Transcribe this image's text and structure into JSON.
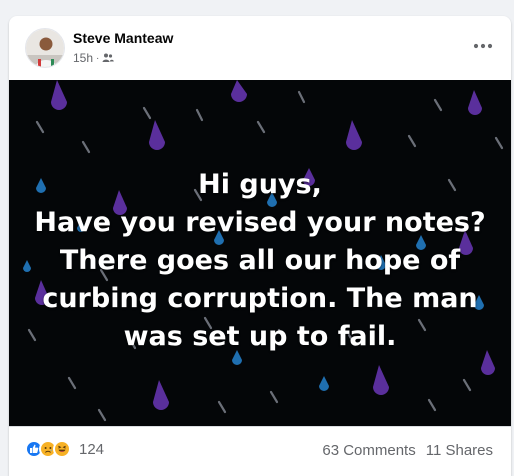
{
  "post": {
    "author": "Steve Manteaw",
    "time": "15h",
    "separator": "·",
    "audience_icon": "friends-icon",
    "more_icon": "more-options-icon",
    "background": {
      "color": "#040608",
      "drop_colors": [
        "#5a2f9c",
        "#1f6fb0",
        "#6b6f78"
      ]
    },
    "text_lines": [
      "Hi guys,",
      "Have you revised your notes?",
      "There goes all our hope of",
      "curbing corruption. The man",
      "was set up to fail."
    ],
    "reactions": {
      "icons": [
        "like-icon",
        "sad-icon",
        "haha-icon"
      ],
      "count": "124"
    },
    "comments": "63 Comments",
    "shares": "11 Shares"
  }
}
